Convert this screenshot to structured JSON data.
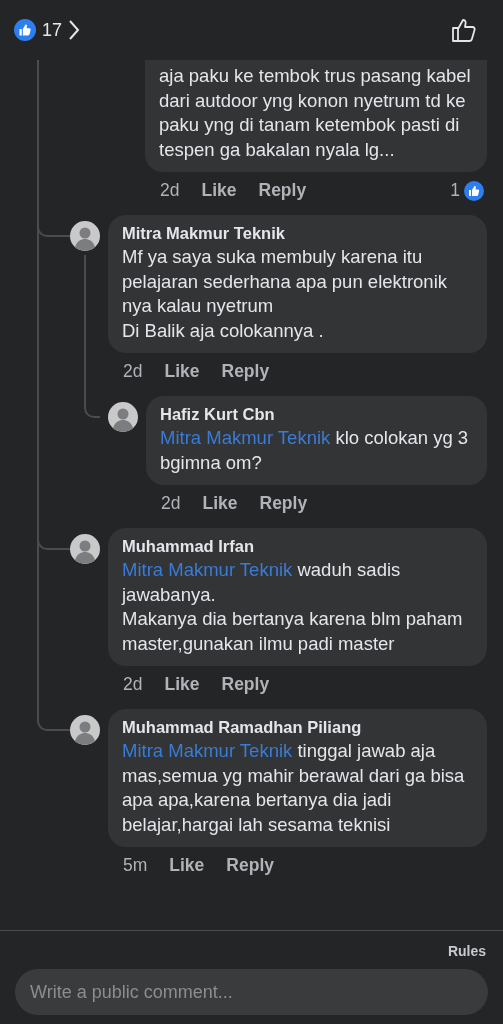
{
  "header": {
    "reaction_count": "17"
  },
  "partial_comment": {
    "text": "aja paku ke tembok trus pasang kabel dari autdoor yng konon nyetrum td ke paku yng di tanam ketembok pasti di tespen ga bakalan nyala lg...",
    "time": "2d",
    "like": "Like",
    "reply": "Reply",
    "reaction_count": "1"
  },
  "replies": [
    {
      "name": "Mitra Makmur Teknik",
      "text": "Mf ya saya suka membuly karena itu pelajaran sederhana apa pun elektronik nya kalau nyetrum\nDi Balik aja colokannya .",
      "time": "2d",
      "like": "Like",
      "reply": "Reply",
      "children": [
        {
          "name": "Hafiz Kurt Cbn",
          "mention": "Mitra Makmur Teknik",
          "text": "klo colokan yg 3 bgimna om?",
          "time": "2d",
          "like": "Like",
          "reply": "Reply"
        }
      ]
    },
    {
      "name": "Muhammad Irfan",
      "mention": "Mitra Makmur Teknik",
      "text": "waduh sadis jawabanya.\nMakanya dia bertanya karena blm paham master,gunakan ilmu padi master",
      "time": "2d",
      "like": "Like",
      "reply": "Reply"
    },
    {
      "name": "Muhammad Ramadhan Piliang",
      "mention": "Mitra Makmur Teknik",
      "text": "tinggal jawab aja mas,semua yg mahir berawal dari ga bisa apa apa,karena bertanya dia jadi belajar,hargai lah sesama teknisi",
      "time": "5m",
      "like": "Like",
      "reply": "Reply"
    }
  ],
  "footer": {
    "rules": "Rules",
    "placeholder": "Write a public comment..."
  }
}
